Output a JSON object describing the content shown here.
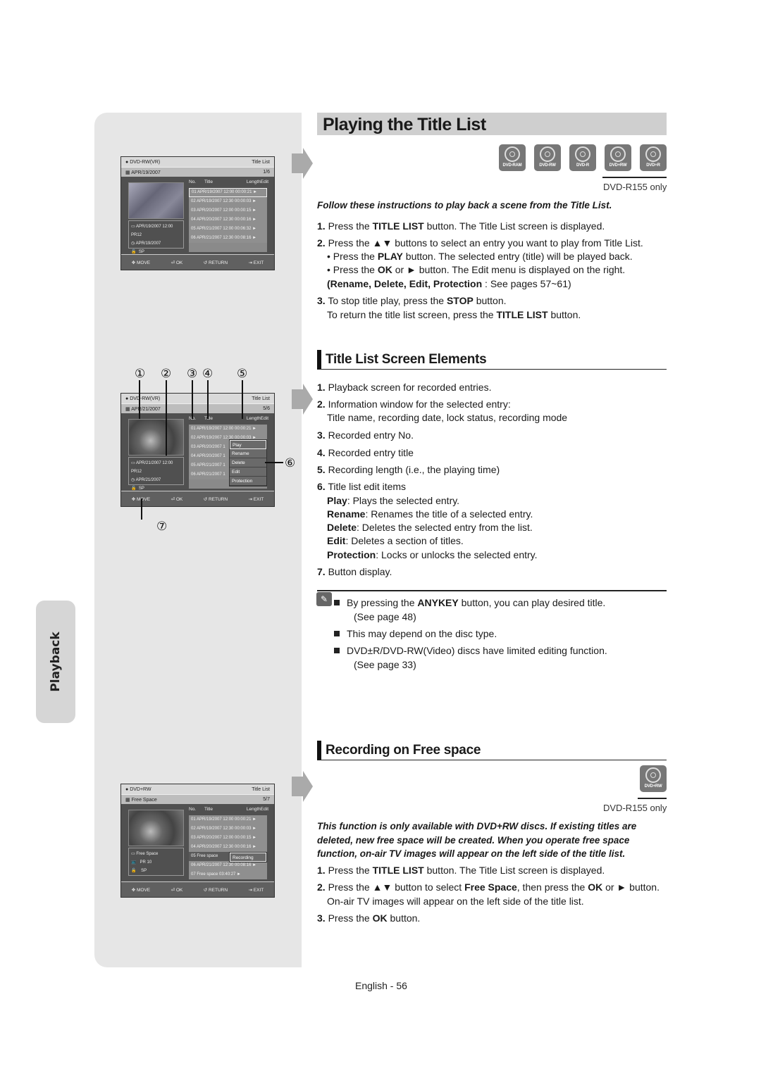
{
  "side_tab": {
    "label": "Playback"
  },
  "page_title": "Playing the Title List",
  "disc_icons": [
    {
      "label": "DVD-RAM"
    },
    {
      "label": "DVD-RW"
    },
    {
      "label": "DVD-R"
    },
    {
      "label": "DVD+RW"
    },
    {
      "label": "DVD+R"
    }
  ],
  "model_note": "DVD-R155 only",
  "section1": {
    "intro": "Follow these instructions to play back a scene from the Title List.",
    "steps": [
      {
        "num": "1.",
        "pre": "Press the ",
        "bold": "TITLE LIST",
        "post": " button. The Title List screen is displayed."
      },
      {
        "num": "2.",
        "pre": "Press the ▲▼ buttons to select an entry you want to play from Title List."
      },
      {
        "sub1_pre": "• Press the ",
        "sub1_bold": "PLAY",
        "sub1_post": " button. The selected entry (title) will be played back."
      },
      {
        "sub2_pre": "• Press the ",
        "sub2_bold": "OK",
        "sub2_mid": " or ► button. The Edit menu is displayed on the right."
      },
      {
        "sub3_bold": "(Rename, Delete, Edit, Protection",
        "sub3_post": " : See pages 57~61)"
      },
      {
        "num": "3.",
        "pre": "To stop title play, press the ",
        "bold": "STOP",
        "post": " button."
      },
      {
        "pre": "To return the title list screen, press the ",
        "bold": "TITLE LIST",
        "post": " button."
      }
    ]
  },
  "section2": {
    "heading": "Title List Screen Elements",
    "items": [
      {
        "num": "1.",
        "text": "Playback screen for recorded entries."
      },
      {
        "num": "2.",
        "text": "Information window for the selected entry:",
        "text2": "Title name, recording date, lock status, recording mode"
      },
      {
        "num": "3.",
        "text": "Recorded entry No."
      },
      {
        "num": "4.",
        "text": "Recorded entry title"
      },
      {
        "num": "5.",
        "text": "Recording length (i.e., the playing time)"
      },
      {
        "num": "6.",
        "text": "Title list edit items"
      },
      {
        "num": "7.",
        "text": "Button display."
      }
    ],
    "edit_items": [
      {
        "bold": "Play",
        "text": ": Plays the selected entry."
      },
      {
        "bold": "Rename",
        "text": ": Renames the title of a selected entry."
      },
      {
        "bold": "Delete",
        "text": ": Deletes the selected entry from the list."
      },
      {
        "bold": "Edit",
        "text": ": Deletes a section of titles."
      },
      {
        "bold": "Protection",
        "text": ": Locks or unlocks the selected entry."
      }
    ]
  },
  "notes": [
    {
      "pre": "By pressing the ",
      "bold": "ANYKEY",
      "post": " button, you can play desired title.",
      "cont": "(See page 48)"
    },
    {
      "pre": "This may depend on the disc type."
    },
    {
      "pre": "DVD±R/DVD-RW(Video) discs have limited editing function.",
      "cont": "(See page 33)"
    }
  ],
  "section3": {
    "heading": "Recording on Free space",
    "disc_icon": "DVD+RW",
    "intro": "This function is only available with DVD+RW discs. If existing titles are deleted, new free space will be created. When you operate free space function, on-air TV images will appear on the left side of the title list.",
    "steps": [
      {
        "num": "1.",
        "pre": "Press the ",
        "bold": "TITLE LIST",
        "post": " button. The Title List screen is displayed."
      },
      {
        "num": "2.",
        "pre": "Press the ▲▼ button to select ",
        "bold": "Free Space",
        "mid": ", then press the ",
        "bold2": "OK",
        "post": " or ► button.",
        "cont": "On-air TV images will appear on the left side of the title list."
      },
      {
        "num": "3.",
        "pre": "Press the ",
        "bold": "OK",
        "post": " button."
      }
    ]
  },
  "osd_common": {
    "header_right": "Title List",
    "col_no": "No.",
    "col_title": "Title",
    "col_length": "Length",
    "col_edit": "Edit",
    "footer": {
      "move": "MOVE",
      "ok": "OK",
      "return": "RETURN",
      "exit": "EXIT"
    }
  },
  "osd1": {
    "disc": "DVD-RW(VR)",
    "sub_left": "APR/19/2007",
    "sub_right": "1/6",
    "info": [
      "APR/19/2007 12:00 PR12",
      "APR/19/2007",
      "SP"
    ],
    "rows": [
      "01 APR/19/2007  12:00  00:00:21  ►",
      "02 APR/19/2007  12:30  00:00:03  ►",
      "03 APR/20/2007  12:00  00:00:15  ►",
      "04 APR/20/2007  12:30  00:00:16  ►",
      "05 APR/21/2007  12:00  00:06:32  ►",
      "06 APR/21/2007  12:30  00:08:16  ►"
    ]
  },
  "osd2": {
    "disc": "DVD-RW(VR)",
    "sub_left": "APR/21/2007",
    "sub_right": "5/6",
    "info": [
      "APR/21/2007 12:00 PR12",
      "APR/21/2007",
      "SP"
    ],
    "rows": [
      "01 APR/19/2007  12:00  00:00:21  ►",
      "02 APR/19/2007  12:30  00:00:03  ►",
      "03 APR/20/2007  1",
      "04 APR/20/2007  1",
      "05 APR/21/2007  1",
      "06 APR/21/2007  1"
    ],
    "menu": [
      "Play",
      "Rename",
      "Delete",
      "Edit",
      "Protection"
    ],
    "callouts": [
      "①",
      "②",
      "③",
      "④",
      "⑤",
      "⑥",
      "⑦"
    ]
  },
  "osd3": {
    "disc": "DVD+RW",
    "sub_left": "Free Space",
    "sub_right": "5/7",
    "info": [
      "Free Space",
      "PR 10",
      "SP"
    ],
    "rows": [
      "01 APR/19/2007  12:00  00:00:21  ►",
      "02 APR/19/2007  12:30  00:00:03  ►",
      "03 APR/20/2007  12:00  00:00:15  ►",
      "04 APR/20/2007  12:30  00:00:16  ►",
      "05 Free space",
      "06 APR/21/2007  12:30  00:08:16  ►",
      "07 Free space                  03:40:27  ►"
    ],
    "menu": [
      "Recording"
    ]
  },
  "page_footer": "English - 56"
}
